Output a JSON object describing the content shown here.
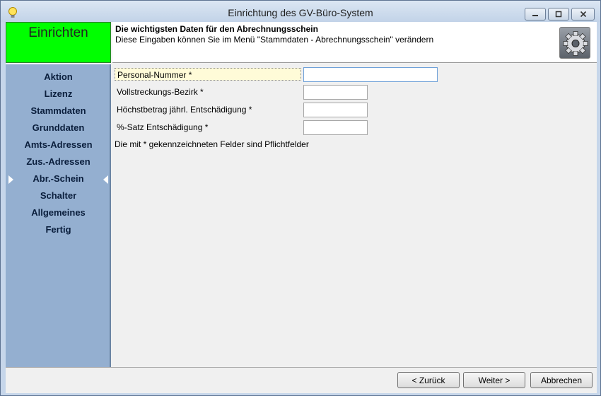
{
  "window": {
    "title": "Einrichtung des GV-Büro-System"
  },
  "header": {
    "section": "Einrichten",
    "heading": "Die wichtigsten Daten für den Abrechnungsschein",
    "subheading": "Diese Eingaben können Sie im Menü \"Stammdaten - Abrechnungsschein\" verändern",
    "icon": "gear-icon"
  },
  "sidebar": {
    "items": [
      {
        "label": "Aktion"
      },
      {
        "label": "Lizenz"
      },
      {
        "label": "Stammdaten"
      },
      {
        "label": "Grunddaten"
      },
      {
        "label": "Amts-Adressen"
      },
      {
        "label": "Zus.-Adressen"
      },
      {
        "label": "Abr.-Schein"
      },
      {
        "label": "Schalter"
      },
      {
        "label": "Allgemeines"
      },
      {
        "label": "Fertig"
      }
    ],
    "selected": "Abr.-Schein"
  },
  "form": {
    "fields": [
      {
        "label": "Personal-Nummer *",
        "value": ""
      },
      {
        "label": "Vollstreckungs-Bezirk *",
        "value": ""
      },
      {
        "label": "Höchstbetrag jährl. Entschädigung *",
        "value": ""
      },
      {
        "label": "%-Satz Entschädigung *",
        "value": ""
      }
    ],
    "note": "Die mit * gekennzeichneten Felder sind Pflichtfelder"
  },
  "buttons": {
    "back": "< Zurück",
    "next": "Weiter >",
    "cancel": "Abbrechen"
  }
}
